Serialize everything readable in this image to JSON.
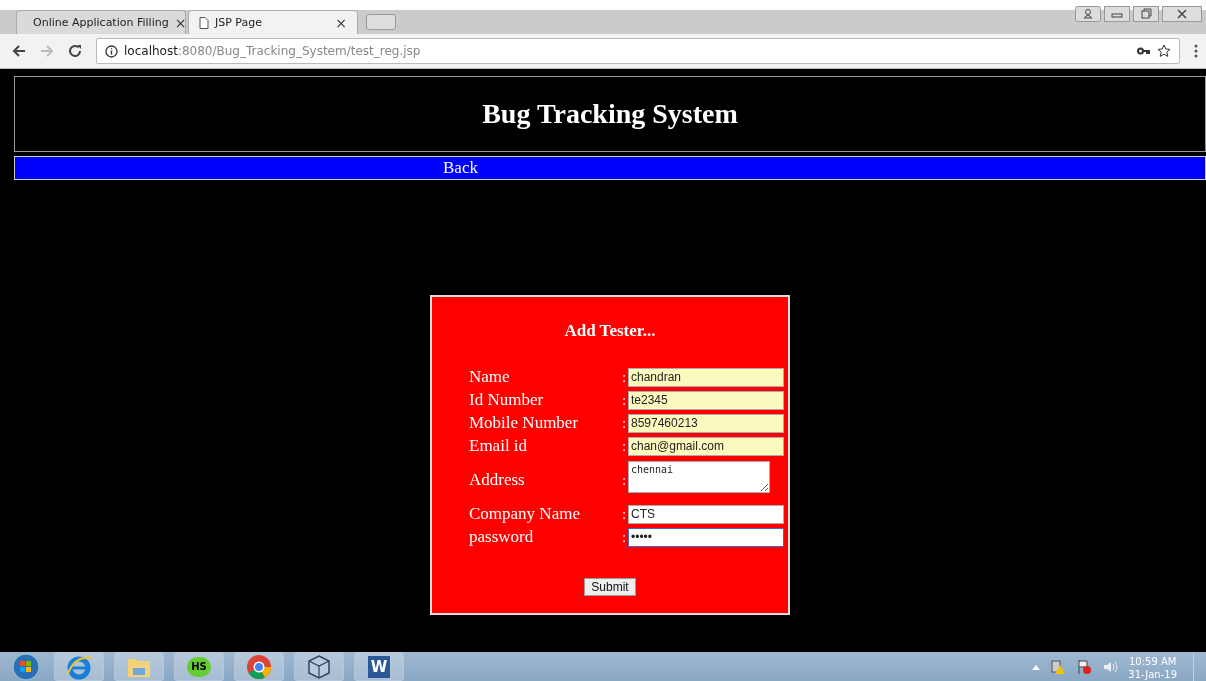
{
  "browser": {
    "tabs": [
      {
        "title": "Online Application Filling",
        "selected": false
      },
      {
        "title": "JSP Page",
        "selected": true
      }
    ],
    "close_glyph": "×",
    "url": {
      "host": "localhost",
      "path": ":8080/Bug_Tracking_System/test_reg.jsp"
    }
  },
  "page": {
    "title": "Bug Tracking System",
    "nav_link": "Back",
    "form": {
      "heading": "Add Tester...",
      "separator": ":",
      "fields": [
        {
          "label": "Name",
          "value": "chandran",
          "kind": "input",
          "autofilled": true,
          "focused": false
        },
        {
          "label": "Id Number",
          "value": "te2345",
          "kind": "input",
          "autofilled": true,
          "focused": false
        },
        {
          "label": "Mobile Number",
          "value": "8597460213",
          "kind": "input",
          "autofilled": true,
          "focused": false
        },
        {
          "label": "Email id",
          "value": "chan@gmail.com",
          "kind": "input",
          "autofilled": true,
          "focused": false
        },
        {
          "label": "Address",
          "value": "chennai",
          "kind": "textarea",
          "autofilled": false,
          "focused": false
        },
        {
          "label": "Company Name",
          "value": "CTS",
          "kind": "input",
          "autofilled": false,
          "focused": false
        },
        {
          "label": "password",
          "value": "•••••",
          "kind": "input",
          "autofilled": false,
          "focused": true
        }
      ],
      "submit": "Submit"
    }
  },
  "taskbar": {
    "apps": [
      {
        "kind": "start"
      },
      {
        "kind": "ie"
      },
      {
        "kind": "folder"
      },
      {
        "kind": "hs",
        "text": "HS"
      },
      {
        "kind": "chrome"
      },
      {
        "kind": "cube"
      },
      {
        "kind": "word",
        "text": "W"
      }
    ],
    "time": "10:59 AM",
    "date": "31-Jan-19"
  }
}
